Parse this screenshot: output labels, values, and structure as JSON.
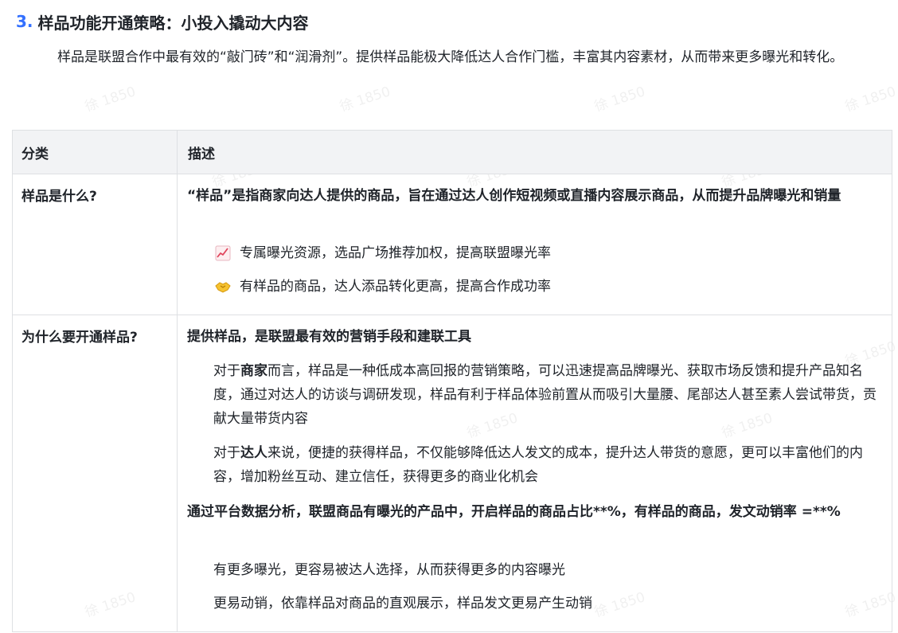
{
  "section": {
    "number": "3.",
    "title": "样品功能开通策略：小投入撬动大内容",
    "intro": "样品是联盟合作中最有效的“敲门砖”和“润滑剂”。提供样品能极大降低达人合作门槛，丰富其内容素材，从而带来更多曝光和转化。"
  },
  "watermark": "徐 1850",
  "table": {
    "headers": [
      "分类",
      "描述"
    ],
    "row1": {
      "category": "样品是什么?",
      "definition": "“样品”是指商家向达人提供的商品，旨在通过达人创作短视频或直播内容展示商品，从而提升品牌曝光和销量",
      "bullets": [
        {
          "icon": "chart-increasing-icon",
          "text": "专属曝光资源，选品广场推荐加权，提高联盟曝光率"
        },
        {
          "icon": "handshake-icon",
          "text": "有样品的商品，达人添品转化更高，提高合作成功率"
        }
      ]
    },
    "row2": {
      "category": "为什么要开通样品?",
      "lead": "提供样品，是联盟最有效的营销手段和建联工具",
      "merchant_prefix": "对于",
      "merchant_keyword": "商家",
      "merchant_text": "而言，样品是一种低成本高回报的营销策略，可以迅速提高品牌曝光、获取市场反馈和提升产品知名度，通过对达人的访谈与调研发现，样品有利于样品体验前置从而吸引大量腰、尾部达人甚至素人尝试带货，贡献大量带货内容",
      "creator_prefix": "对于",
      "creator_keyword": "达人",
      "creator_text": "来说，便捷的获得样品，不仅能够降低达人发文的成本，提升达人带货的意愿，更可以丰富他们的内容，增加粉丝互动、建立信任，获得更多的商业化机会",
      "stat": "通过平台数据分析，联盟商品有曝光的产品中，开启样品的商品占比**%，有样品的商品，发文动销率 =**%",
      "benefits": [
        "有更多曝光，更容易被达人选择，从而获得更多的内容曝光",
        "更易动销，依靠样品对商品的直观展示，样品发文更易产生动销"
      ]
    }
  }
}
